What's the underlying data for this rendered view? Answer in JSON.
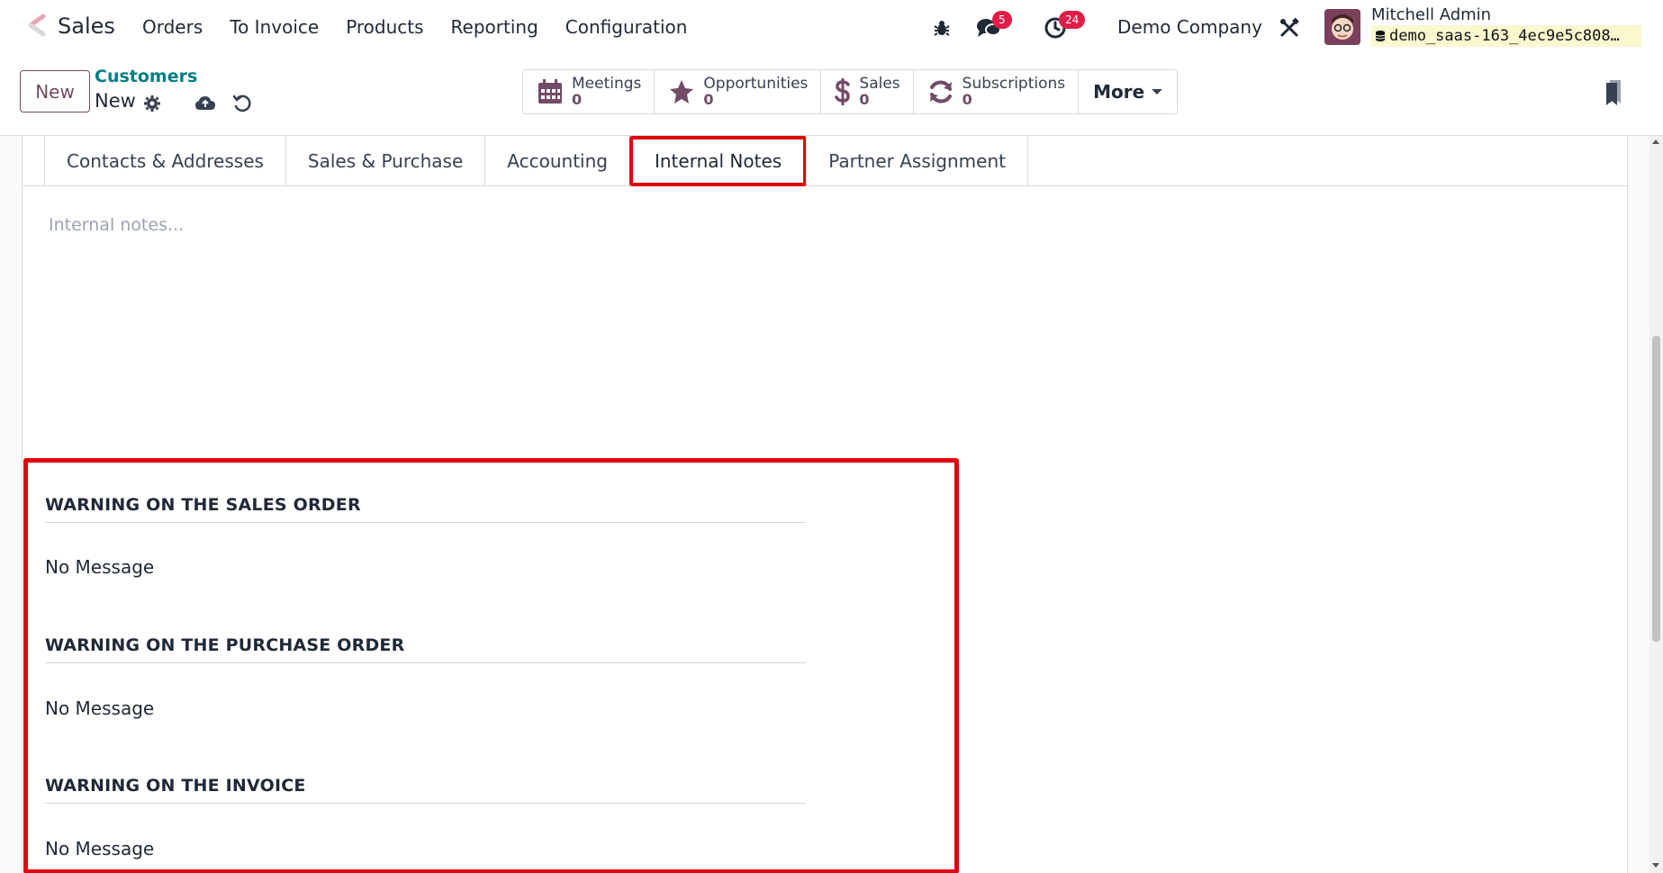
{
  "navbar": {
    "app_name": "Sales",
    "menu": [
      "Orders",
      "To Invoice",
      "Products",
      "Reporting",
      "Configuration"
    ],
    "messages_count": "5",
    "activities_count": "24",
    "company": "Demo Company",
    "user_name": "Mitchell Admin",
    "database": "demo_saas-163_4ec9e5c808…"
  },
  "control_panel": {
    "new_label": "New",
    "breadcrumb_parent": "Customers",
    "breadcrumb_current": "New",
    "smart_buttons": [
      {
        "label": "Meetings",
        "value": "0",
        "icon": "calendar-icon"
      },
      {
        "label": "Opportunities",
        "value": "0",
        "icon": "star-icon"
      },
      {
        "label": "Sales",
        "value": "0",
        "icon": "dollar-icon"
      },
      {
        "label": "Subscriptions",
        "value": "0",
        "icon": "refresh-icon"
      }
    ],
    "more_label": "More"
  },
  "tabs": [
    "Contacts & Addresses",
    "Sales & Purchase",
    "Accounting",
    "Internal Notes",
    "Partner Assignment"
  ],
  "active_tab": "Internal Notes",
  "notes_placeholder": "Internal notes...",
  "warnings": [
    {
      "title": "WARNING ON THE SALES ORDER",
      "value": "No Message"
    },
    {
      "title": "WARNING ON THE PURCHASE ORDER",
      "value": "No Message"
    },
    {
      "title": "WARNING ON THE INVOICE",
      "value": "No Message"
    }
  ],
  "colors": {
    "brand": "#714b67",
    "link": "#017e84",
    "highlight": "#e10510",
    "badge": "#e11d48"
  }
}
